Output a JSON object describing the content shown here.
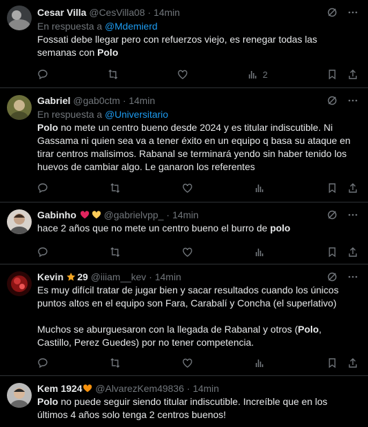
{
  "tweets": [
    {
      "name": "Cesar Villa",
      "handle": "@CesVilla08",
      "time": "14min",
      "reply_prefix": "En respuesta a",
      "reply_to": "@Mdemierd",
      "text_parts": [
        {
          "t": "Fossati debe llegar pero con refuerzos viejo, es renegar todas las semanas con ",
          "b": false
        },
        {
          "t": "Polo",
          "b": true
        }
      ],
      "views": "2",
      "avatar_color": "#6b6b6b"
    },
    {
      "name": "Gabriel",
      "handle": "@gab0ctm",
      "time": "14min",
      "reply_prefix": "En respuesta a",
      "reply_to": "@Universitario",
      "text_parts": [
        {
          "t": "Polo",
          "b": true
        },
        {
          "t": " no mete un centro bueno desde 2024 y es titular indiscutible. Ni Gassama ni quien sea va a tener éxito en un equipo q basa su ataque en tirar centros malisimos. Rabanal se terminará yendo sin haber tenido los huevos de cambiar algo. Le ganaron los referentes",
          "b": false
        }
      ],
      "views": "",
      "avatar_color": "#8a8f5a"
    },
    {
      "name": "Gabinho",
      "handle": "@gabrielvpp_",
      "time": "14min",
      "text_parts": [
        {
          "t": "hace 2 años que no mete un centro bueno el burro de ",
          "b": false
        },
        {
          "t": "polo",
          "b": true
        }
      ],
      "views": "",
      "avatar_color": "#b9a89a"
    },
    {
      "name": "Kevin",
      "badge": "29",
      "handle": "@iiiam__kev",
      "time": "14min",
      "text_parts": [
        {
          "t": "Es muy difícil tratar de jugar bien y sacar resultados cuando los únicos puntos altos en el equipo son Fara, Carabalí y Concha (el superlativo)\n\nMuchos se aburguesaron con la llegada de Rabanal y otros (",
          "b": false
        },
        {
          "t": "Polo",
          "b": true
        },
        {
          "t": ", Castillo, Perez Guedes) por no tener competencia.",
          "b": false
        }
      ],
      "views": "",
      "avatar_color": "#7a1010"
    },
    {
      "name": "Kem 1924",
      "handle": "@AlvarezKem49836",
      "time": "14min",
      "text_parts": [
        {
          "t": "Polo",
          "b": true
        },
        {
          "t": " no puede seguir siendo titular indiscutible. Increíble que en los últimos 4 años solo tenga 2 centros buenos!",
          "b": false
        }
      ],
      "views": "",
      "avatar_color": "#9a9a9a"
    }
  ]
}
